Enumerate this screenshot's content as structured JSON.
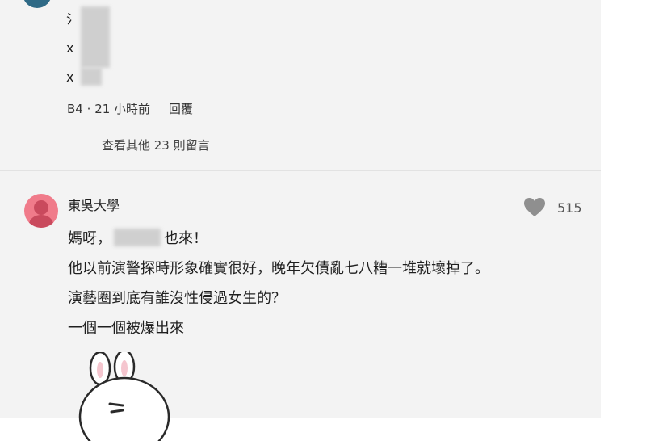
{
  "previous_comment": {
    "lines": [
      "氵",
      "x",
      "x"
    ],
    "floor": "B4",
    "sep": "·",
    "time": "21 小時前",
    "reply_label": "回覆"
  },
  "view_more": {
    "label": "查看其他 23 則留言"
  },
  "comment": {
    "author": "東吳大學",
    "like_count": "515",
    "line1_prefix": "媽呀，",
    "line1_suffix": "也來！",
    "line2": "他以前演警探時形象確實很好，晚年欠債亂七八糟一堆就壞掉了。",
    "line3": "演藝圈到底有誰沒性侵過女生的？",
    "line4": "一個一個被爆出來"
  },
  "icons": {
    "like": "heart-icon",
    "avatar": "user-avatar-icon",
    "sticker": "bunny-sticker"
  },
  "colors": {
    "panel_bg": "#f3f3f3",
    "avatar": "#f07b8a",
    "heart": "#8f8f8f"
  }
}
